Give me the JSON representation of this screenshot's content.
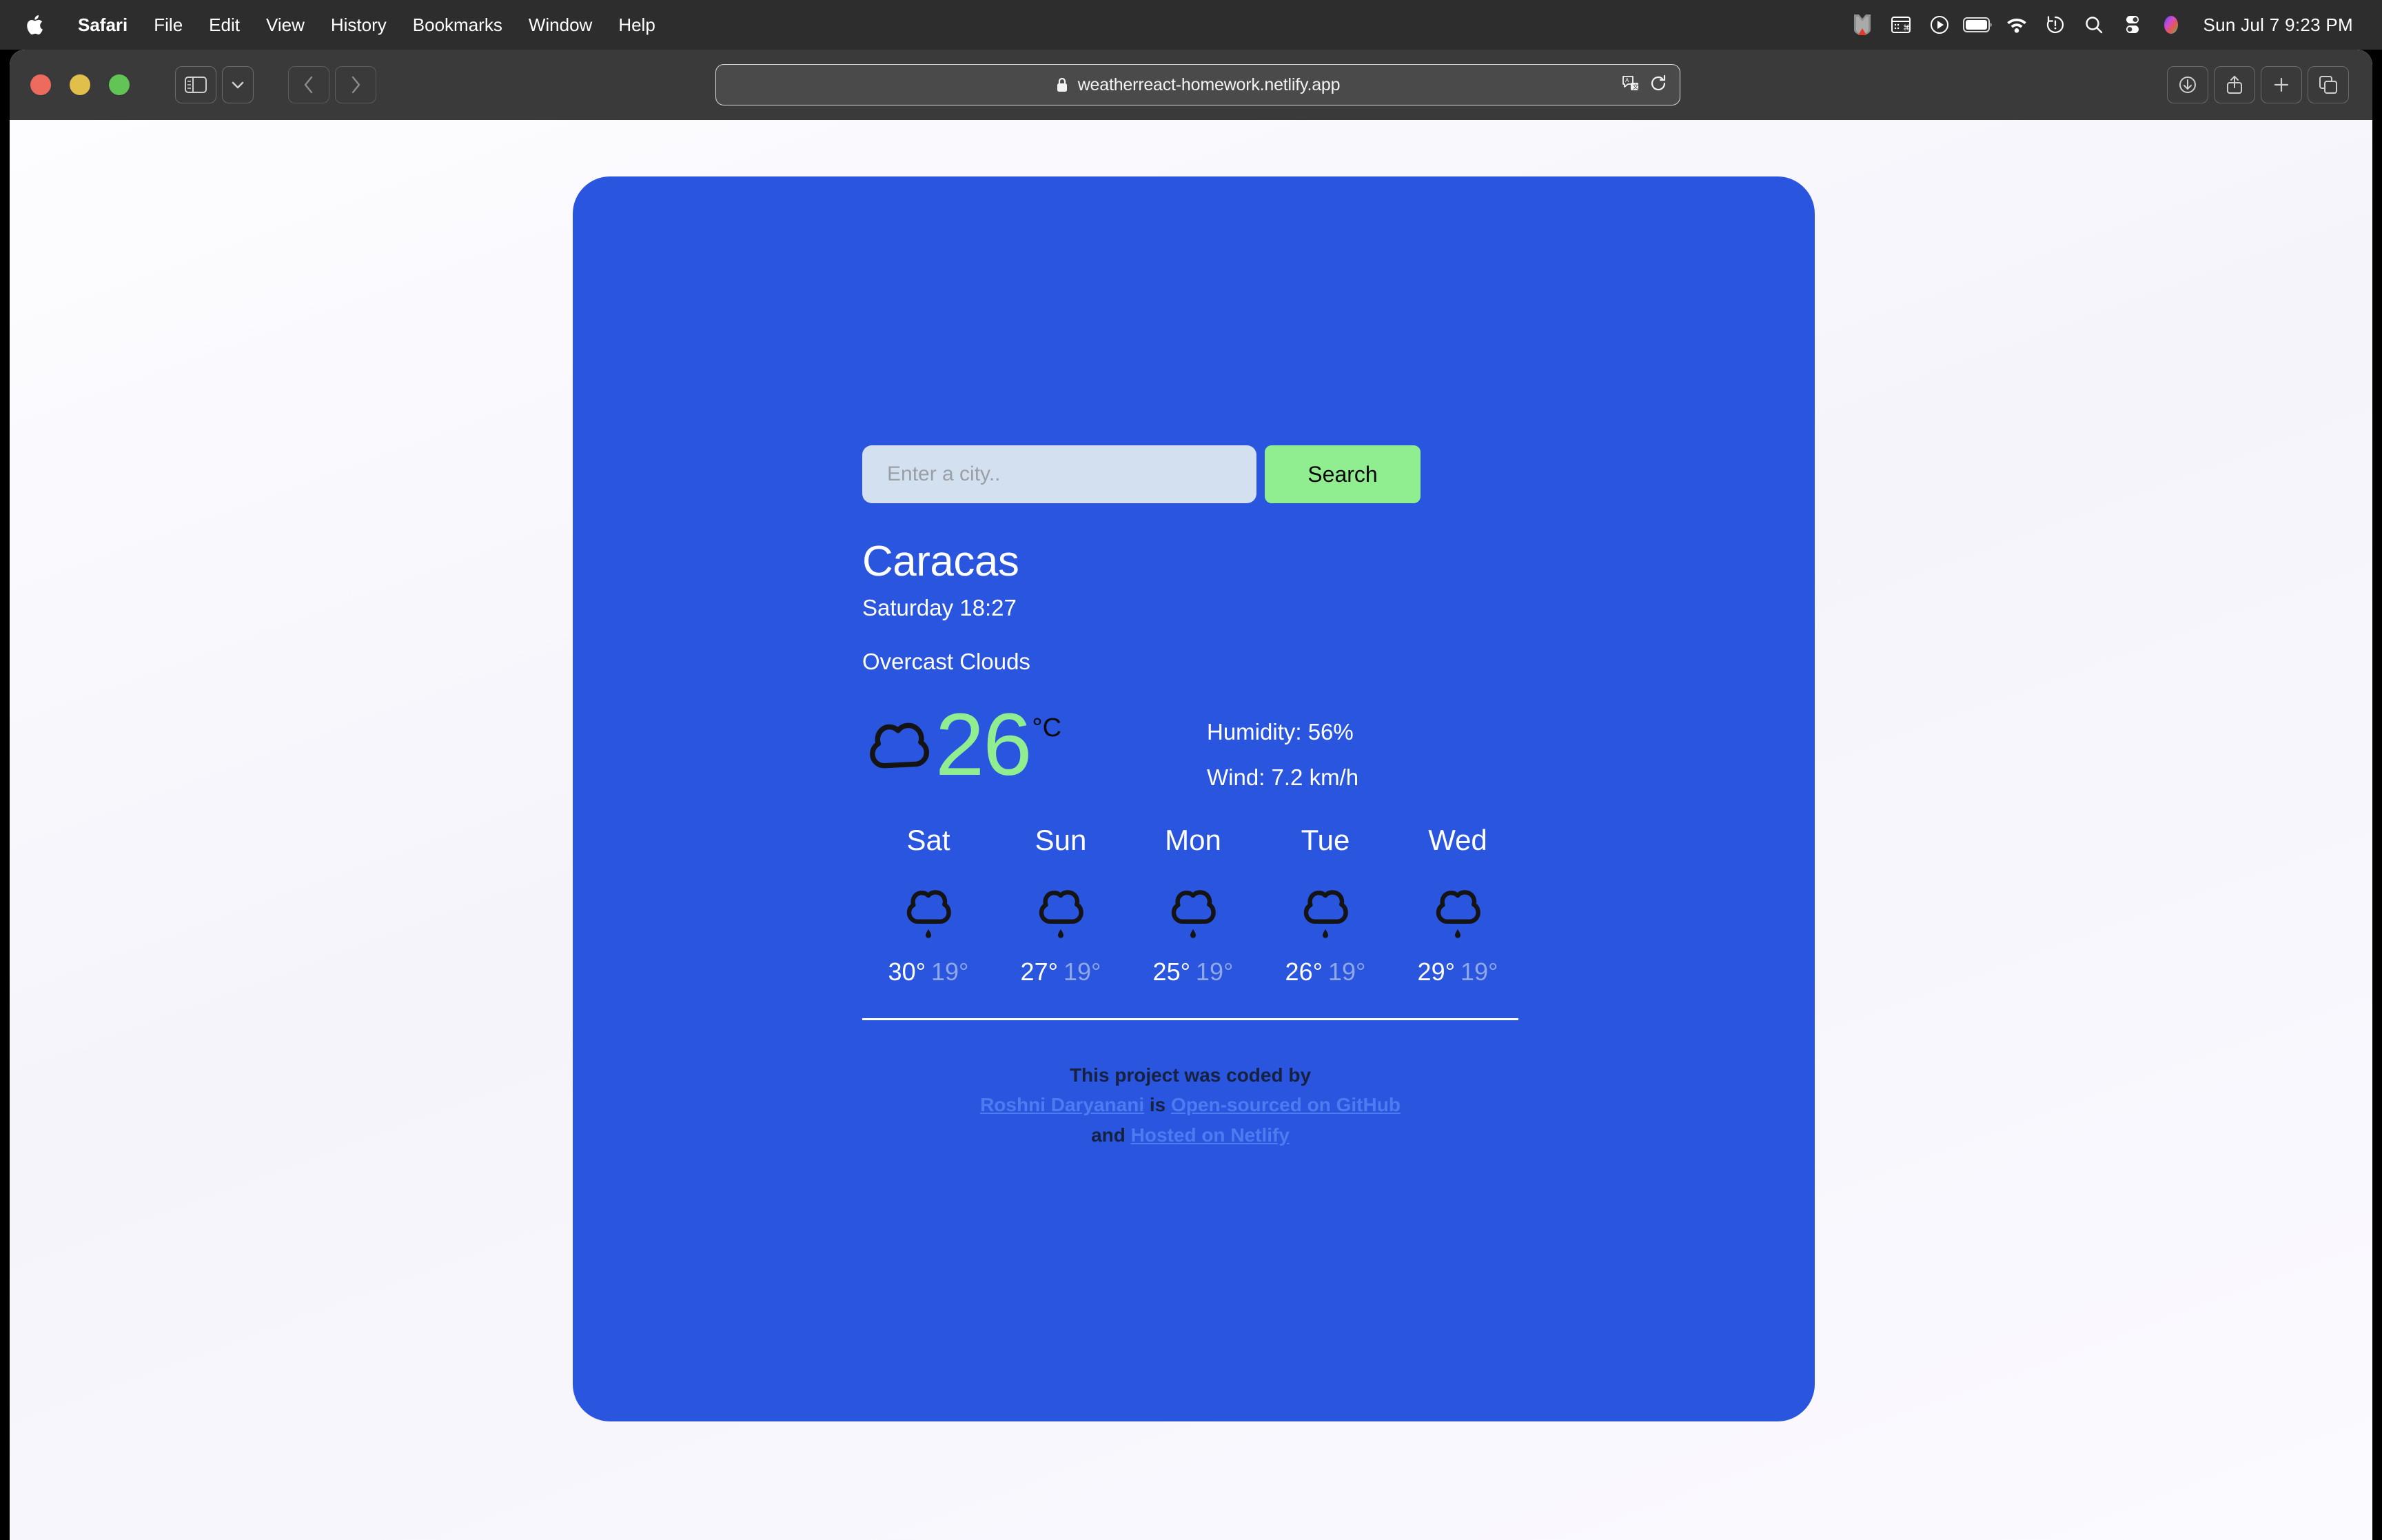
{
  "menubar": {
    "apple_icon": "apple-logo-icon",
    "items": [
      {
        "label": "Safari",
        "bold": true
      },
      {
        "label": "File",
        "bold": false
      },
      {
        "label": "Edit",
        "bold": false
      },
      {
        "label": "View",
        "bold": false
      },
      {
        "label": "History",
        "bold": false
      },
      {
        "label": "Bookmarks",
        "bold": false
      },
      {
        "label": "Window",
        "bold": false
      },
      {
        "label": "Help",
        "bold": false
      }
    ],
    "status_icons": [
      "malwarebytes-icon",
      "keyboard-input-icon",
      "play-circle-icon",
      "battery-icon",
      "wifi-icon",
      "time-machine-icon",
      "spotlight-search-icon",
      "control-center-icon",
      "siri-icon"
    ],
    "clock": "Sun Jul 7  9:23 PM"
  },
  "browser": {
    "traffic_lights": [
      "close",
      "minimize",
      "zoom"
    ],
    "sidebar_button": "sidebar-icon",
    "tab_overview_button": "chevron-down-icon",
    "back_button": "chevron-left-icon",
    "forward_button": "chevron-right-icon",
    "url": "weatherreact-homework.netlify.app",
    "lock_icon": "lock-icon",
    "translate_icon": "translate-icon",
    "reload_icon": "reload-icon",
    "downloads_icon": "downloads-icon",
    "share_icon": "share-icon",
    "new_tab_icon": "plus-icon",
    "tab_overview_icon": "tabs-icon"
  },
  "app": {
    "card_color": "#2a55df",
    "accent_green": "#90ee90",
    "input_bg": "#d3e0f0",
    "search": {
      "placeholder": "Enter a city..",
      "value": "",
      "button_label": "Search"
    },
    "current": {
      "city": "Caracas",
      "datetime": "Saturday 18:27",
      "description": "Overcast Clouds",
      "temperature": "26",
      "unit": "°C",
      "icon": "cloud-icon",
      "humidity": "Humidity: 56%",
      "wind": "Wind: 7.2 km/h"
    },
    "forecast": [
      {
        "day": "Sat",
        "icon": "cloud-rain-icon",
        "max": "30°",
        "min": "19°"
      },
      {
        "day": "Sun",
        "icon": "cloud-rain-icon",
        "max": "27°",
        "min": "19°"
      },
      {
        "day": "Mon",
        "icon": "cloud-rain-icon",
        "max": "25°",
        "min": "19°"
      },
      {
        "day": "Tue",
        "icon": "cloud-rain-icon",
        "max": "26°",
        "min": "19°"
      },
      {
        "day": "Wed",
        "icon": "cloud-rain-icon",
        "max": "29°",
        "min": "19°"
      }
    ],
    "footer": {
      "line1": "This project was coded by",
      "author": "Roshni Daryanani",
      "connector_is": "is",
      "github_link": "Open-sourced on GitHub",
      "connector_and": "and",
      "netlify_link": "Hosted on Netlify"
    }
  }
}
